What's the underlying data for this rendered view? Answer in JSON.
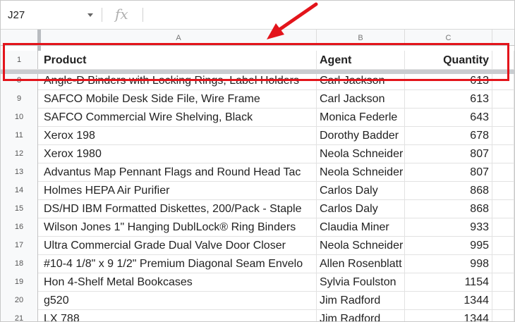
{
  "name_box": {
    "value": "J27"
  },
  "formula_bar": {
    "fx_icon": "fx",
    "value": ""
  },
  "column_headers": [
    "A",
    "B",
    "C"
  ],
  "header_row": {
    "row_number": "1",
    "product": "Product",
    "agent": "Agent",
    "quantity": "Quantity"
  },
  "rows": [
    {
      "row_number": "8",
      "product": "Angle-D Binders with Locking Rings, Label Holders",
      "agent": "Carl Jackson",
      "quantity": "613"
    },
    {
      "row_number": "9",
      "product": "SAFCO Mobile Desk Side File, Wire Frame",
      "agent": "Carl Jackson",
      "quantity": "613"
    },
    {
      "row_number": "10",
      "product": "SAFCO Commercial Wire Shelving, Black",
      "agent": "Monica Federle",
      "quantity": "643"
    },
    {
      "row_number": "11",
      "product": "Xerox 198",
      "agent": "Dorothy Badder",
      "quantity": "678"
    },
    {
      "row_number": "12",
      "product": "Xerox 1980",
      "agent": "Neola Schneider",
      "quantity": "807"
    },
    {
      "row_number": "13",
      "product": "Advantus Map Pennant Flags and Round Head Tac",
      "agent": "Neola Schneider",
      "quantity": "807"
    },
    {
      "row_number": "14",
      "product": "Holmes HEPA Air Purifier",
      "agent": "Carlos Daly",
      "quantity": "868"
    },
    {
      "row_number": "15",
      "product": "DS/HD IBM Formatted Diskettes, 200/Pack - Staple",
      "agent": "Carlos Daly",
      "quantity": "868"
    },
    {
      "row_number": "16",
      "product": "Wilson Jones 1\" Hanging DublLock® Ring Binders",
      "agent": "Claudia Miner",
      "quantity": "933"
    },
    {
      "row_number": "17",
      "product": "Ultra Commercial Grade Dual Valve Door Closer",
      "agent": "Neola Schneider",
      "quantity": "995"
    },
    {
      "row_number": "18",
      "product": "#10-4 1/8\" x 9 1/2\" Premium Diagonal Seam Envelo",
      "agent": "Allen Rosenblatt",
      "quantity": "998"
    },
    {
      "row_number": "19",
      "product": "Hon 4-Shelf Metal Bookcases",
      "agent": "Sylvia Foulston",
      "quantity": "1154"
    },
    {
      "row_number": "20",
      "product": "g520",
      "agent": "Jim Radford",
      "quantity": "1344"
    },
    {
      "row_number": "21",
      "product": "LX 788",
      "agent": "Jim Radford",
      "quantity": "1344"
    }
  ],
  "annotation": {
    "box_color": "#e3141b",
    "arrow_color": "#e3141b"
  }
}
